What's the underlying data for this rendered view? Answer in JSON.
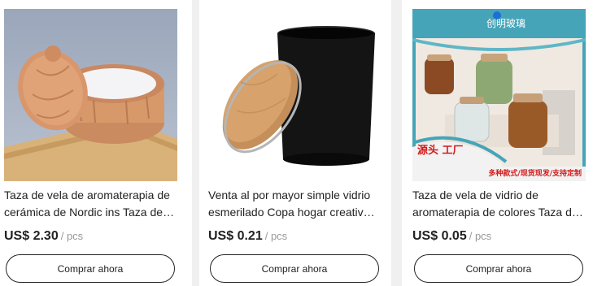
{
  "products": [
    {
      "title": "Taza de vela de aromaterapia de cerámica de Nordic ins Taza de vela",
      "price": "US$ 2.30",
      "unit": "/ pcs",
      "button_label": "Comprar ahora"
    },
    {
      "title": "Venta al por mayor simple vidrio esmerilado Copa hogar creativo vela",
      "price": "US$ 0.21",
      "unit": "/ pcs",
      "button_label": "Comprar ahora"
    },
    {
      "title": "Taza de vela de vidrio de aromaterapia de colores Taza de vela",
      "price": "US$ 0.05",
      "unit": "/ pcs",
      "button_label": "Comprar ahora",
      "image_overlay": {
        "brand": "创明玻璃",
        "badge": "源头 工厂",
        "tagline": "多种款式/现货现发/支持定制"
      }
    }
  ]
}
